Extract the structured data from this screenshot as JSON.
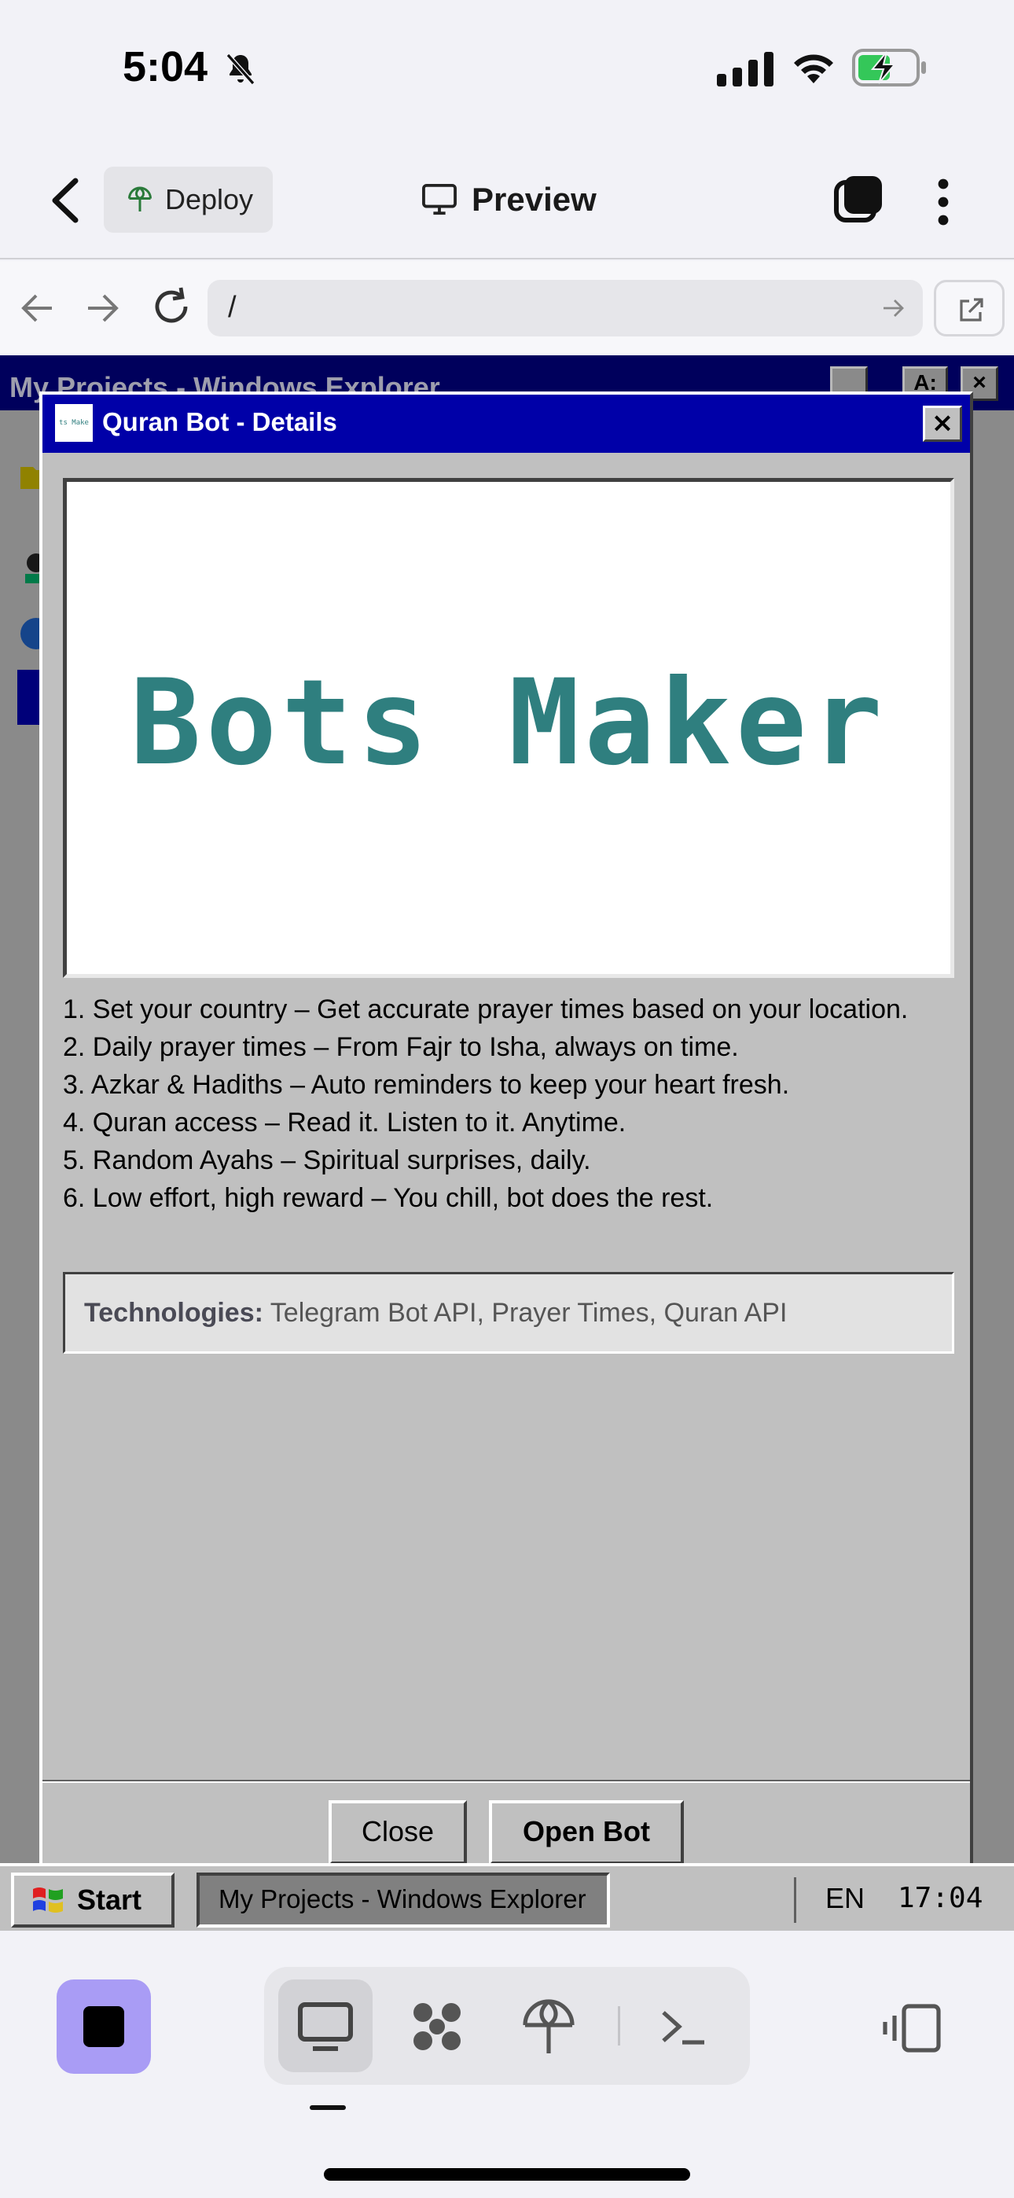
{
  "status_bar": {
    "time": "5:04"
  },
  "app_bar": {
    "deploy_label": "Deploy",
    "preview_label": "Preview"
  },
  "browser": {
    "url": "/"
  },
  "explorer": {
    "title": "My Projects - Windows Explorer",
    "minimize_label": "_",
    "maximize_label": "A:",
    "close_label": "×"
  },
  "dialog": {
    "title": "Quran Bot - Details",
    "close_icon_label": "×",
    "banner_text": "Bots Maker",
    "logo_text": "ts Make",
    "features": [
      "1. Set your country – Get accurate prayer times based on your location.",
      "2. Daily prayer times – From Fajr to Isha, always on time.",
      "3. Azkar & Hadiths – Auto reminders to keep your heart fresh.",
      "4. Quran access – Read it. Listen to it. Anytime.",
      "5. Random Ayahs – Spiritual surprises, daily.",
      "6. Low effort, high reward – You chill, bot does the rest."
    ],
    "technologies_label": "Technologies:",
    "technologies_value": "Telegram Bot API, Prayer Times, Quran API",
    "close_button": "Close",
    "open_button": "Open Bot"
  },
  "taskbar": {
    "start_label": "Start",
    "task_label": "My Projects - Windows Explorer",
    "language": "EN",
    "clock": "17:04"
  },
  "colors": {
    "titlebar": "#0000a8",
    "win_gray": "#c0c0c0",
    "banner_text": "#2f7f7f",
    "stop_button": "#a99cf5"
  },
  "icons": [
    "bell-slash-icon",
    "signal-icon",
    "wifi-icon",
    "battery-charging-icon",
    "back-chevron-icon",
    "deploy-icon",
    "monitor-icon",
    "stack-icon",
    "more-icon",
    "arrow-left-icon",
    "arrow-right-icon",
    "reload-icon",
    "external-link-icon",
    "windows-logo-icon",
    "stop-icon",
    "desktop-icon",
    "apps-icon",
    "deploy-tab-icon",
    "terminal-icon",
    "layout-icon"
  ]
}
